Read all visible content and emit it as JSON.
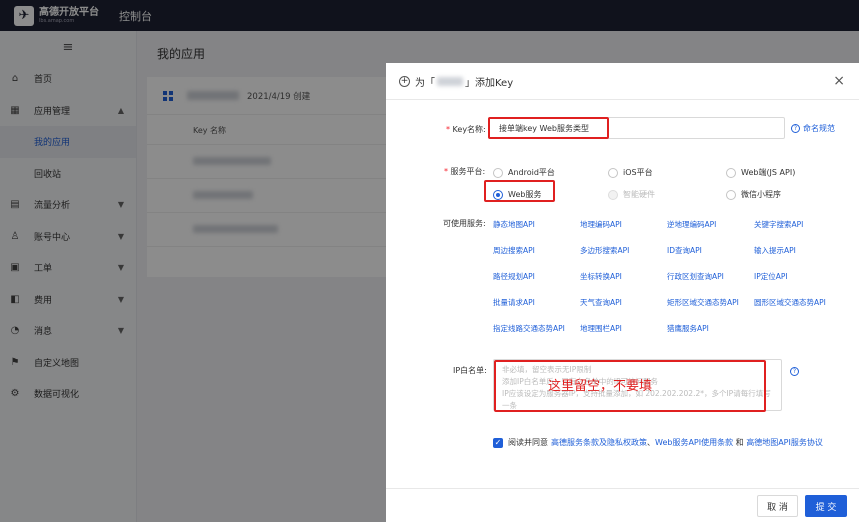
{
  "header": {
    "logo_text": "高德开放平台",
    "logo_sub": "lbs.amap.com",
    "console": "控制台"
  },
  "sidebar": {
    "menu_icon": "menu-icon",
    "items": [
      {
        "label": "首页",
        "icon": "home-icon"
      },
      {
        "label": "应用管理",
        "icon": "apps-icon",
        "expanded": true
      },
      {
        "label": "我的应用",
        "active": true
      },
      {
        "label": "回收站"
      },
      {
        "label": "流量分析",
        "icon": "chart-icon"
      },
      {
        "label": "账号中心",
        "icon": "user-icon"
      },
      {
        "label": "工单",
        "icon": "ticket-icon"
      },
      {
        "label": "费用",
        "icon": "billing-icon"
      },
      {
        "label": "消息",
        "icon": "message-icon"
      },
      {
        "label": "自定义地图",
        "icon": "map-icon"
      },
      {
        "label": "数据可视化",
        "icon": "visual-icon"
      }
    ]
  },
  "main": {
    "title": "我的应用",
    "app_card": {
      "date": "2021/4/19 创建",
      "key_col": "Key 名称"
    }
  },
  "modal": {
    "title_prefix": "为「",
    "title_suffix": "」添加Key",
    "close": "×",
    "key_name": {
      "label": "Key名称:",
      "value": "接单端key  Web服务类型",
      "help": "命名规范"
    },
    "platform": {
      "label": "服务平台:",
      "options": [
        {
          "label": "Android平台",
          "selected": false,
          "disabled": false
        },
        {
          "label": "iOS平台",
          "selected": false,
          "disabled": false
        },
        {
          "label": "Web端(JS API)",
          "selected": false,
          "disabled": false
        },
        {
          "label": "Web服务",
          "selected": true,
          "disabled": false
        },
        {
          "label": "智能硬件",
          "selected": false,
          "disabled": true
        },
        {
          "label": "微信小程序",
          "selected": false,
          "disabled": false
        }
      ]
    },
    "services": {
      "label": "可使用服务:",
      "items": [
        "静态地图API",
        "地理编码API",
        "逆地理编码API",
        "关键字搜索API",
        "周边搜索API",
        "多边形搜索API",
        "ID查询API",
        "输入提示API",
        "路径规划API",
        "坐标转换API",
        "行政区划查询API",
        "IP定位API",
        "批量请求API",
        "天气查询API",
        "矩形区域交通态势API",
        "圆形区域交通态势API",
        "指定线路交通态势API",
        "地理围栏API",
        "猎鹰服务API"
      ]
    },
    "ip_whitelist": {
      "label": "IP白名单:",
      "placeholder": "非必填，留空表示无IP限制\n添加IP白名单后，只有白名单中的IP可访问服务\nIP应该设定为服务器IP，支持批量添加，如 202.202.202.2*，多个IP请每行填写一条",
      "annotation": "这里留空，不要填"
    },
    "agreement": {
      "prefix": "阅读并同意",
      "link1": "高德服务条款及隐私权政策",
      "sep1": "、",
      "link2": "Web服务API使用条款",
      "sep2": " 和 ",
      "link3": "高德地图API服务协议"
    },
    "buttons": {
      "cancel": "取 消",
      "submit": "提 交"
    }
  },
  "colors": {
    "accent": "#1f5fd8",
    "annotation_red": "#e02020",
    "topbar": "#1e2233"
  }
}
